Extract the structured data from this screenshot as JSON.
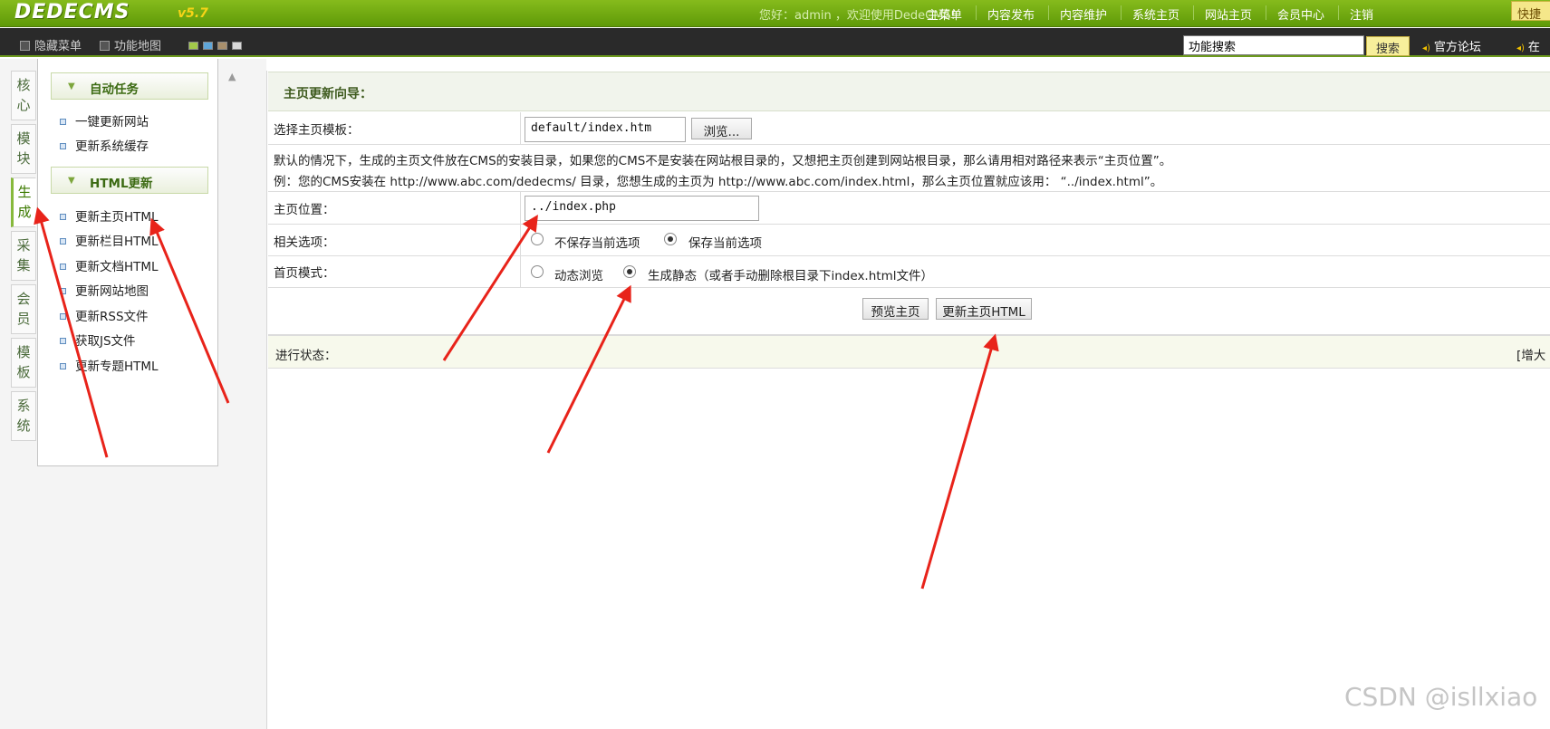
{
  "header": {
    "logo": "DEDECMS",
    "version": "v5.7",
    "greeting": "您好：admin ，欢迎使用DedeCMS!",
    "nav": [
      "主菜单",
      "内容发布",
      "内容维护",
      "系统主页",
      "网站主页",
      "会员中心",
      "注销"
    ],
    "quick_label": "快捷"
  },
  "toolbar": {
    "hide_menu": "隐藏菜单",
    "function_map": "功能地图",
    "skin_colors": [
      "#a2c94a",
      "#5fa6d9",
      "#a88f6c",
      "#d8d8d8"
    ],
    "search_value": "功能搜索",
    "search_button": "搜索",
    "forum_link": "官方论坛",
    "next_link": "在"
  },
  "left_tabs": [
    {
      "label": "核心",
      "active": false
    },
    {
      "label": "模块",
      "active": false
    },
    {
      "label": "生成",
      "active": true
    },
    {
      "label": "采集",
      "active": false
    },
    {
      "label": "会员",
      "active": false
    },
    {
      "label": "模板",
      "active": false
    },
    {
      "label": "系统",
      "active": false
    }
  ],
  "menu": {
    "section1_title": "自动任务",
    "section1_items": [
      "一键更新网站",
      "更新系统缓存"
    ],
    "section2_title": "HTML更新",
    "section2_items": [
      "更新主页HTML",
      "更新栏目HTML",
      "更新文档HTML",
      "更新网站地图",
      "更新RSS文件",
      "获取JS文件",
      "更新专题HTML"
    ]
  },
  "main": {
    "title": "主页更新向导：",
    "template_label": "选择主页模板：",
    "template_value": "default/index.htm",
    "browse_button": "浏览...",
    "note_line1": "默认的情况下，生成的主页文件放在CMS的安装目录，如果您的CMS不是安装在网站根目录的，又想把主页创建到网站根目录，那么请用相对路径来表示“主页位置”。",
    "note_line2": "例：您的CMS安装在 http://www.abc.com/dedecms/ 目录，您想生成的主页为 http://www.abc.com/index.html，那么主页位置就应该用： “../index.html”。",
    "position_label": "主页位置：",
    "position_value": "../index.php",
    "options_label": "相关选项：",
    "option_no_save": "不保存当前选项",
    "option_save": "保存当前选项",
    "options_selected": "保存当前选项",
    "mode_label": "首页模式：",
    "mode_dynamic": "动态浏览",
    "mode_static": "生成静态（或者手动删除根目录下index.html文件）",
    "mode_selected": "生成静态",
    "preview_button": "预览主页",
    "update_button": "更新主页HTML",
    "status_label": "进行状态：",
    "enlarge_label": "[增大"
  },
  "watermark": "CSDN @isllxiao",
  "annotation_color": "#e8231a"
}
